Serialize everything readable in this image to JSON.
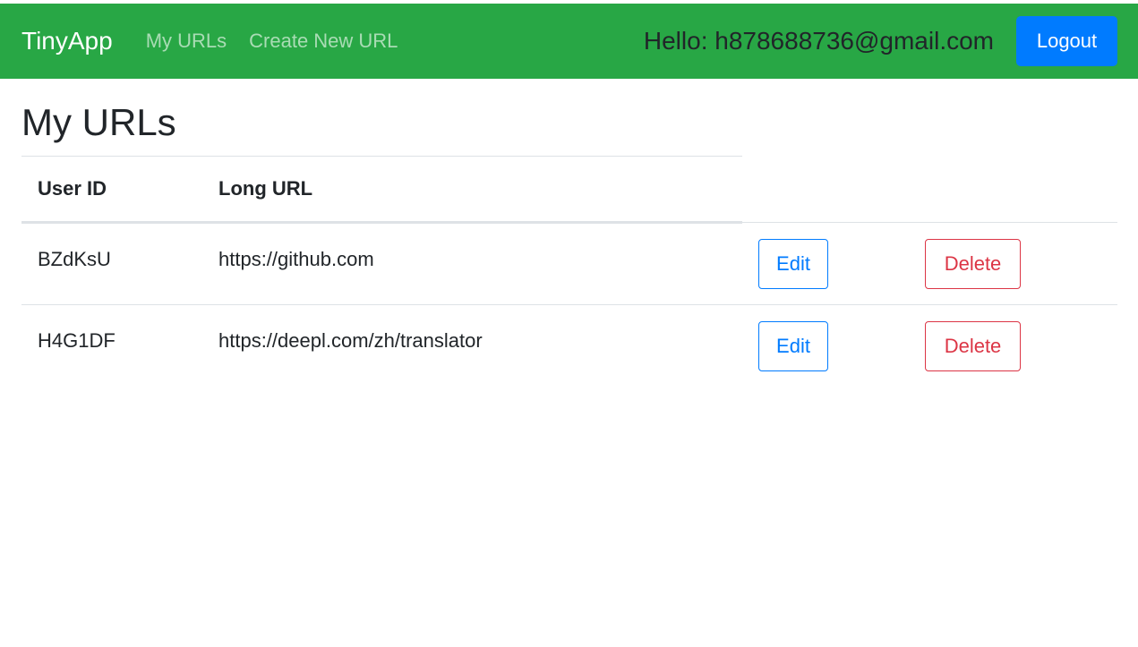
{
  "nav": {
    "brand": "TinyApp",
    "links": [
      "My URLs",
      "Create New URL"
    ],
    "greeting": "Hello: h878688736@gmail.com",
    "logout_label": "Logout"
  },
  "main": {
    "title": "My URLs",
    "table": {
      "headers": [
        "User ID",
        "Long URL"
      ],
      "rows": [
        {
          "id": "BZdKsU",
          "long_url": "https://github.com",
          "edit_label": "Edit",
          "delete_label": "Delete"
        },
        {
          "id": "H4G1DF",
          "long_url": "https://deepl.com/zh/translator",
          "edit_label": "Edit",
          "delete_label": "Delete"
        }
      ]
    }
  },
  "colors": {
    "navbar": "#28a745",
    "primary": "#007bff",
    "danger": "#dc3545"
  }
}
